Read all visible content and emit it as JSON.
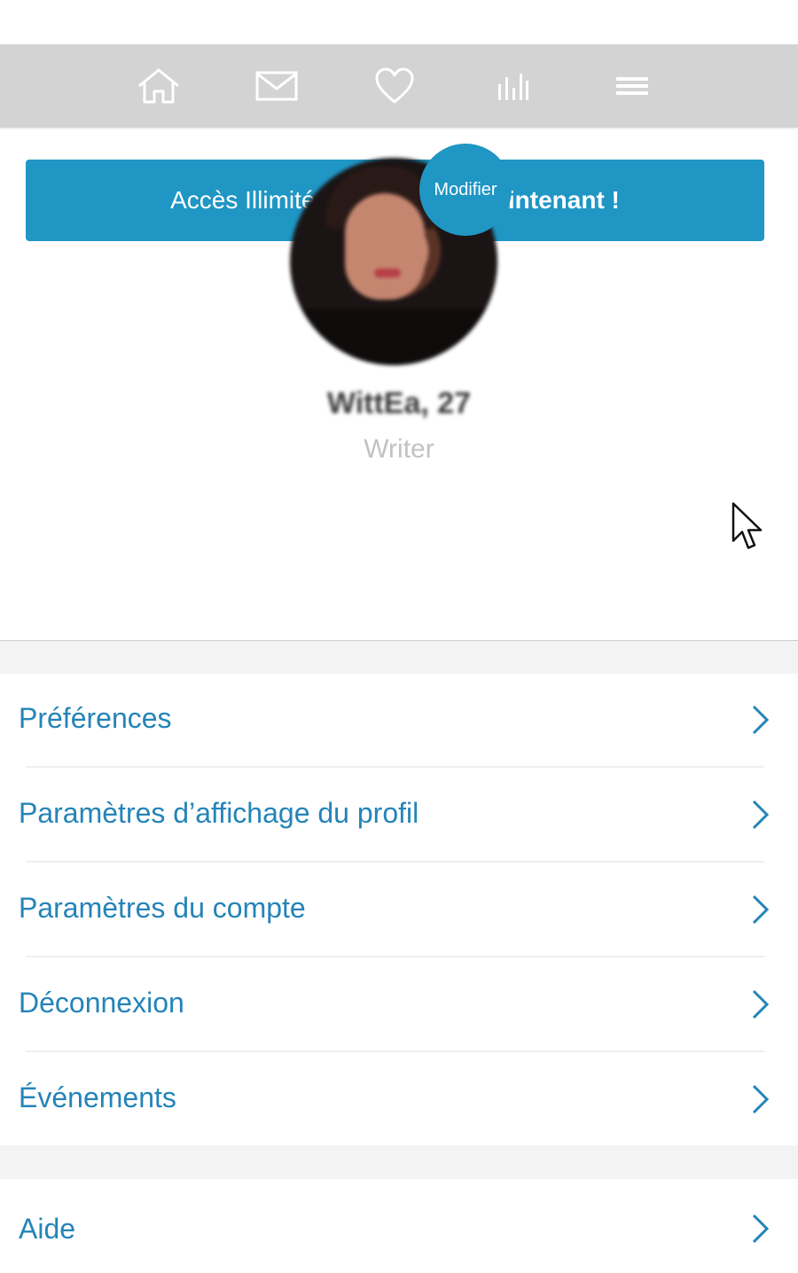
{
  "nav": {
    "items": [
      {
        "icon": "home-icon"
      },
      {
        "icon": "mail-icon"
      },
      {
        "icon": "heart-icon"
      },
      {
        "icon": "bar-chart-icon"
      },
      {
        "icon": "menu-icon"
      }
    ]
  },
  "banner": {
    "prefix": "Accès Illimité",
    "separator": "-",
    "cta": "Souscrivez maintenant !"
  },
  "profile": {
    "modify_label": "Modifier",
    "name_age": "WittEa, 27",
    "occupation": "Writer"
  },
  "menu": {
    "items": [
      {
        "label": "Préférences"
      },
      {
        "label": "Paramètres d’affichage du profil"
      },
      {
        "label": "Paramètres du compte"
      },
      {
        "label": "Déconnexion"
      },
      {
        "label": "Événements"
      }
    ],
    "secondary": [
      {
        "label": "Aide"
      }
    ]
  },
  "colors": {
    "accent": "#1f96c4",
    "link": "#2484b8",
    "navbar": "#d3d3d3",
    "section_gap": "#f3f3f3"
  }
}
